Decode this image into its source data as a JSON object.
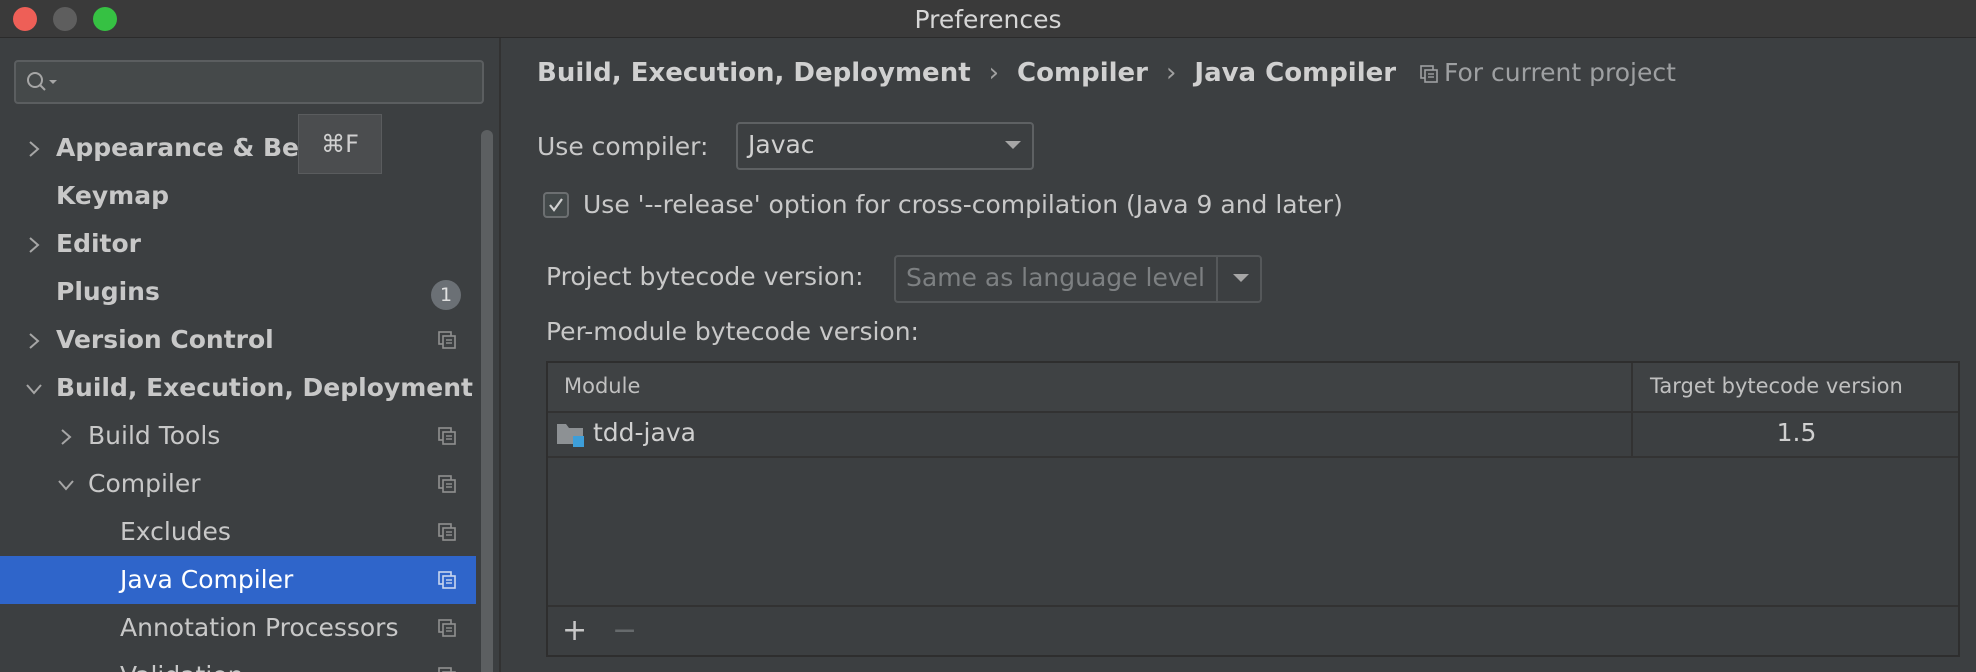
{
  "window": {
    "title": "Preferences"
  },
  "search": {
    "placeholder": "",
    "shortcut_tooltip": "⌘F"
  },
  "sidebar": {
    "items": [
      {
        "label": "Appearance & Behavior",
        "visible_label": "Appearance & Beh",
        "expandable": true,
        "expanded": false,
        "bold": true
      },
      {
        "label": "Keymap",
        "bold": true
      },
      {
        "label": "Editor",
        "expandable": true,
        "expanded": false,
        "bold": true
      },
      {
        "label": "Plugins",
        "bold": true,
        "badge": "1"
      },
      {
        "label": "Version Control",
        "expandable": true,
        "expanded": false,
        "bold": true,
        "project_icon": true
      },
      {
        "label": "Build, Execution, Deployment",
        "expandable": true,
        "expanded": true,
        "bold": true
      },
      {
        "label": "Build Tools",
        "expandable": true,
        "expanded": false,
        "level": 1,
        "project_icon": true
      },
      {
        "label": "Compiler",
        "expandable": true,
        "expanded": true,
        "level": 1,
        "project_icon": true
      },
      {
        "label": "Excludes",
        "level": 2,
        "project_icon": true
      },
      {
        "label": "Java Compiler",
        "level": 2,
        "selected": true,
        "project_icon": true
      },
      {
        "label": "Annotation Processors",
        "level": 2,
        "project_icon": true
      },
      {
        "label": "Validation",
        "level": 2,
        "project_icon": true,
        "partially_visible": true
      }
    ]
  },
  "breadcrumb": [
    "Build, Execution, Deployment",
    "Compiler",
    "Java Compiler"
  ],
  "breadcrumb_sep": "›",
  "scope_label": "For current project",
  "compiler": {
    "use_compiler_label": "Use compiler:",
    "use_compiler_value": "Javac",
    "release_option_label": "Use '--release' option for cross-compilation (Java 9 and later)",
    "release_option_checked": true,
    "project_bytecode_label": "Project bytecode version:",
    "project_bytecode_value": "Same as language level",
    "per_module_label": "Per-module bytecode version:"
  },
  "module_table": {
    "columns": [
      "Module",
      "Target bytecode version"
    ],
    "rows": [
      {
        "module": "tdd-java",
        "target": "1.5"
      }
    ],
    "add_label": "+",
    "remove_label": "−"
  },
  "colors": {
    "background": "#3c3f41",
    "selection": "#2f65ca",
    "text": "#bbbbbb"
  }
}
